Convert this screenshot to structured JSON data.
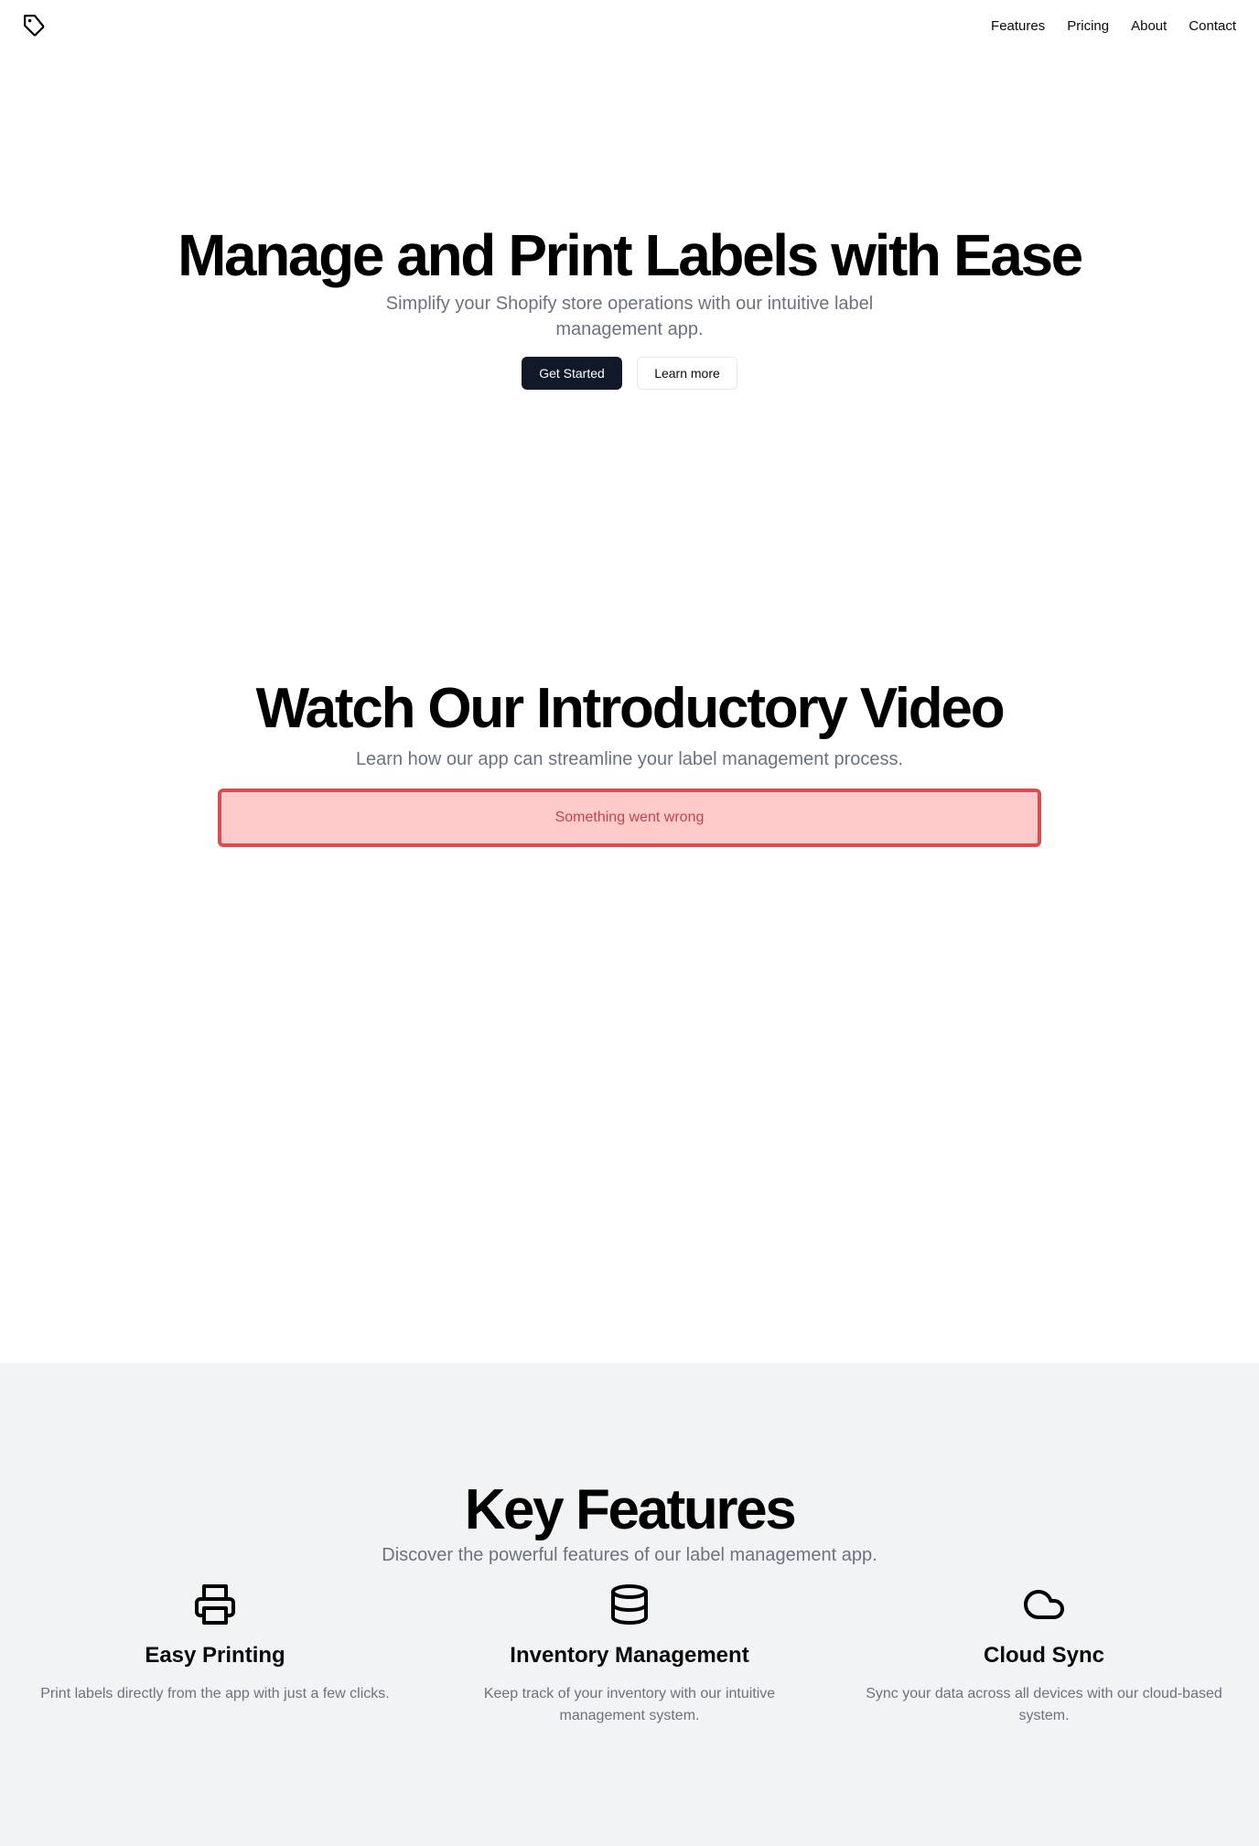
{
  "header": {
    "logo_icon": "tag-icon",
    "nav": [
      "Features",
      "Pricing",
      "About",
      "Contact"
    ]
  },
  "hero": {
    "title": "Manage and Print Labels with Ease",
    "subtitle": "Simplify your Shopify store operations with our intuitive label management app.",
    "primary_button": "Get Started",
    "secondary_button": "Learn more"
  },
  "video": {
    "title": "Watch Our Introductory Video",
    "subtitle": "Learn how our app can streamline your label management process.",
    "error": "Something went wrong"
  },
  "features": {
    "title": "Key Features",
    "subtitle": "Discover the powerful features of our label management app.",
    "items": [
      {
        "icon": "printer-icon",
        "title": "Easy Printing",
        "text": "Print labels directly from the app with just a few clicks."
      },
      {
        "icon": "database-icon",
        "title": "Inventory Management",
        "text": "Keep track of your inventory with our intuitive management system."
      },
      {
        "icon": "cloud-icon",
        "title": "Cloud Sync",
        "text": "Sync your data across all devices with our cloud-based system."
      }
    ]
  },
  "colors": {
    "primary_button_bg": "#111827",
    "error_bg": "#fecaca",
    "error_border": "#dc4c4c",
    "error_text": "#c2454d",
    "muted_text": "#6b7280",
    "features_bg": "#f2f3f5"
  }
}
